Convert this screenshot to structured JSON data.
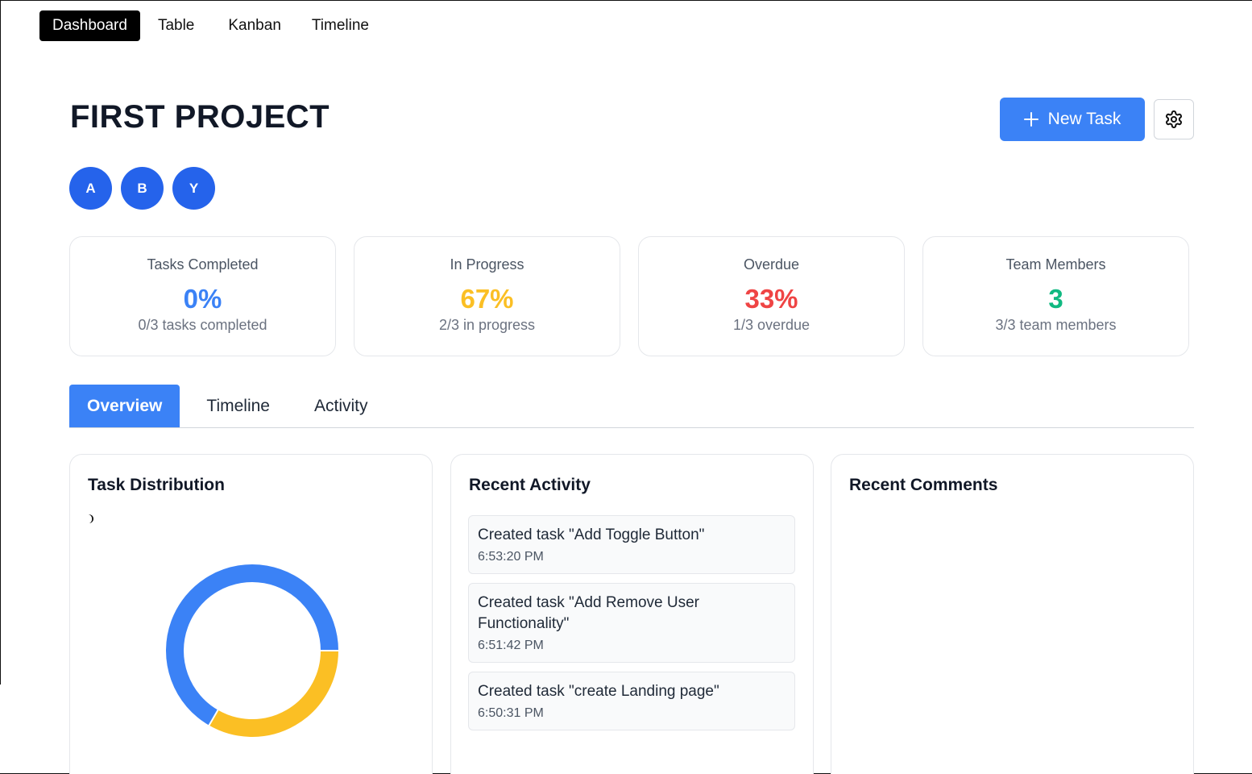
{
  "nav": {
    "items": [
      {
        "label": "Dashboard",
        "active": true
      },
      {
        "label": "Table",
        "active": false
      },
      {
        "label": "Kanban",
        "active": false
      },
      {
        "label": "Timeline",
        "active": false
      }
    ]
  },
  "header": {
    "title": "FIRST PROJECT",
    "new_task_label": "New Task",
    "new_task_icon": "plus-icon",
    "settings_icon": "gear-icon"
  },
  "members": [
    "A",
    "B",
    "Y"
  ],
  "stats": [
    {
      "label": "Tasks Completed",
      "value": "0%",
      "sub": "0/3 tasks completed",
      "color": "#3b82f6"
    },
    {
      "label": "In Progress",
      "value": "67%",
      "sub": "2/3 in progress",
      "color": "#fbbf24"
    },
    {
      "label": "Overdue",
      "value": "33%",
      "sub": "1/3 overdue",
      "color": "#ef4444"
    },
    {
      "label": "Team Members",
      "value": "3",
      "sub": "3/3 team members",
      "color": "#10b981"
    }
  ],
  "tabs": [
    {
      "label": "Overview",
      "active": true
    },
    {
      "label": "Timeline",
      "active": false
    },
    {
      "label": "Activity",
      "active": false
    }
  ],
  "panels": {
    "distribution_title": "Task Distribution",
    "activity_title": "Recent Activity",
    "comments_title": "Recent Comments"
  },
  "distribution": {
    "segments": [
      {
        "fraction": 0.6667,
        "color": "#3b82f6"
      },
      {
        "fraction": 0.3333,
        "color": "#fbbf24"
      }
    ]
  },
  "activity": [
    {
      "text": "Created task \"Add Toggle Button\"",
      "time": "6:53:20 PM"
    },
    {
      "text": "Created task \"Add Remove User Functionality\"",
      "time": "6:51:42 PM"
    },
    {
      "text": "Created task \"create Landing page\"",
      "time": "6:50:31 PM"
    }
  ],
  "colors": {
    "primary": "#3b82f6",
    "avatar": "#2563eb",
    "in_progress": "#fbbf24",
    "overdue": "#ef4444",
    "members": "#10b981"
  }
}
